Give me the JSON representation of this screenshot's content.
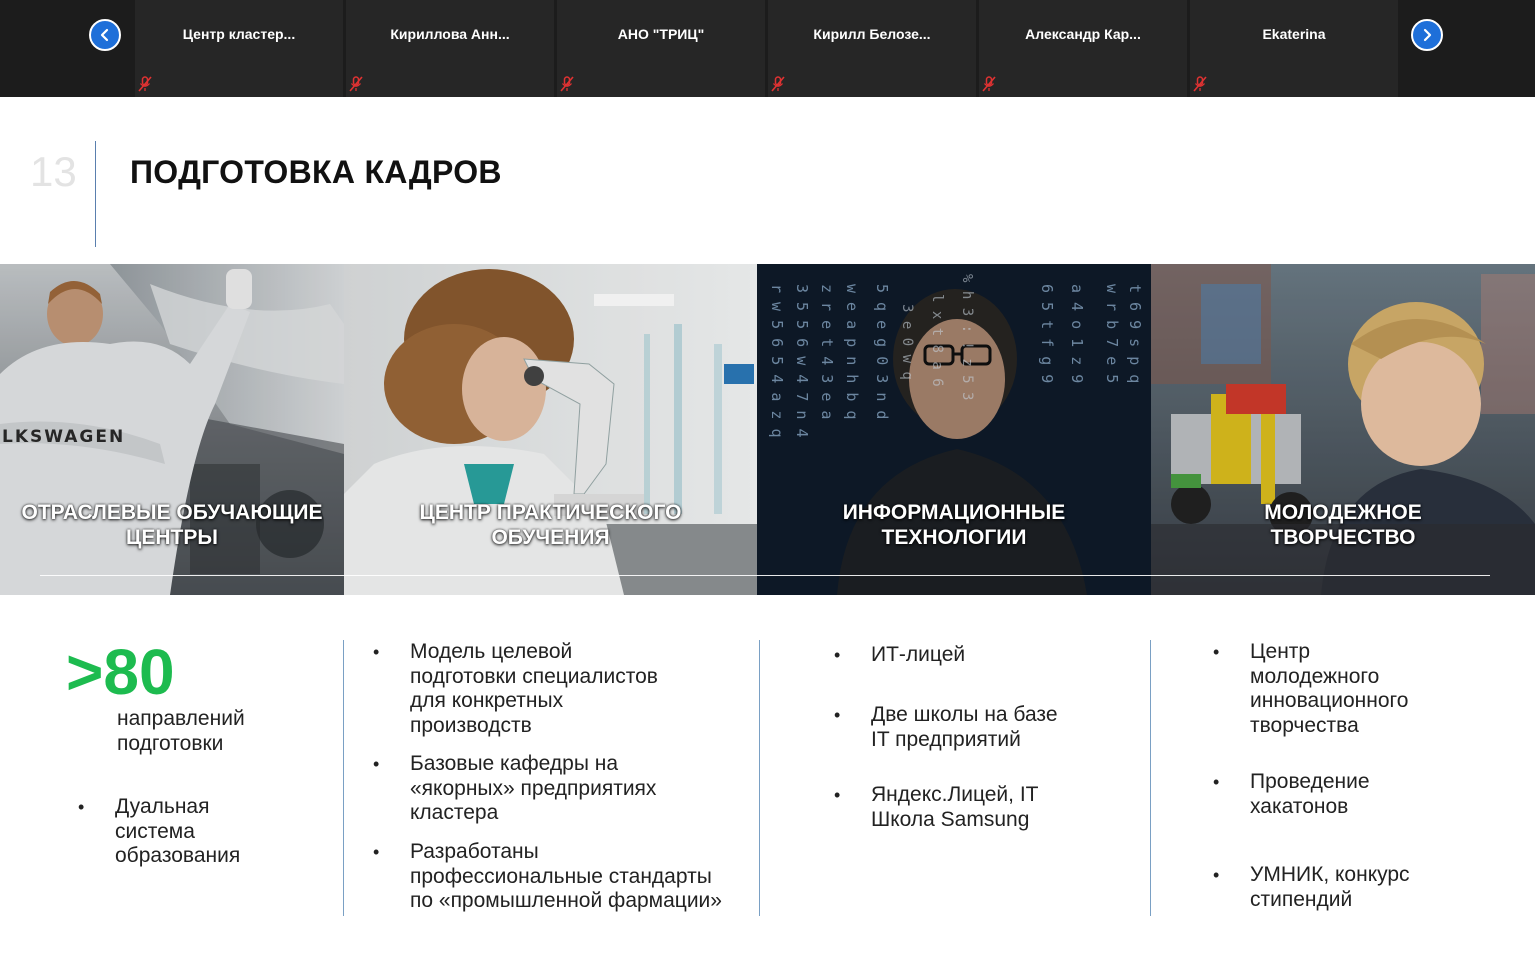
{
  "participants": [
    {
      "name": "Центр  кластер..."
    },
    {
      "name": "Кириллова  Анн..."
    },
    {
      "name": "АНО \"ТРИЦ\""
    },
    {
      "name": "Кирилл  Белозе..."
    },
    {
      "name": "Александр  Кар..."
    },
    {
      "name": "Ekaterina"
    }
  ],
  "icons": {
    "prev": "chevron-left-icon",
    "next": "chevron-right-icon",
    "mic": "mic-muted-icon"
  },
  "colors": {
    "accent_green": "#1dbb4f",
    "nav_blue": "#1e6fd9",
    "muted_red": "#e03232"
  },
  "slide": {
    "number": "13",
    "title": "ПОДГОТОВКА КАДРОВ",
    "panels": [
      {
        "line1": "ОТРАСЛЕВЫЕ ОБУЧАЮЩИЕ",
        "line2": "ЦЕНТРЫ",
        "logo_text": "LKSWAGEN"
      },
      {
        "line1": "ЦЕНТР ПРАКТИЧЕСКОГО",
        "line2": "ОБУЧЕНИЯ"
      },
      {
        "line1": "ИНФОРМАЦИОННЫЕ",
        "line2": "ТЕХНОЛОГИИ"
      },
      {
        "line1": "МОЛОДЕЖНОЕ",
        "line2": "ТВОРЧЕСТВО"
      }
    ],
    "col1": {
      "big_number": ">80",
      "big_caption": [
        "направлений",
        "подготовки"
      ],
      "bullets": [
        {
          "lines": [
            "Дуальная",
            "система",
            "образования"
          ]
        }
      ]
    },
    "col2": {
      "bullets": [
        {
          "lines": [
            "Модель целевой",
            "подготовки специалистов",
            "для конкретных",
            "производств"
          ]
        },
        {
          "lines": [
            "Базовые кафедры на",
            "«якорных» предприятиях",
            "кластера"
          ]
        },
        {
          "lines": [
            "Разработаны",
            "профессиональные стандарты",
            "по «промышленной фармации»"
          ]
        }
      ]
    },
    "col3": {
      "bullets": [
        {
          "lines": [
            "ИТ-лицей"
          ]
        },
        {
          "lines": [
            "Две школы на базе",
            "IT предприятий"
          ]
        },
        {
          "lines": [
            "Яндекс.Лицей, IT",
            "Школа Samsung"
          ]
        }
      ]
    },
    "col4": {
      "bullets": [
        {
          "lines": [
            "Центр",
            "молодежного",
            "инновационного",
            "творчества"
          ]
        },
        {
          "lines": [
            "Проведение",
            "хакатонов"
          ]
        },
        {
          "lines": [
            "УМНИК, конкурс",
            "стипендий"
          ]
        }
      ]
    }
  }
}
